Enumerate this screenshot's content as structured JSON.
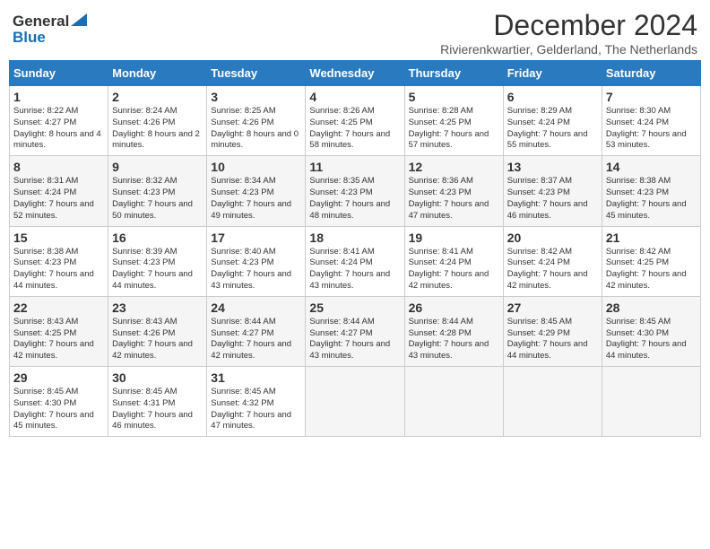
{
  "header": {
    "logo_line1": "General",
    "logo_line2": "Blue",
    "month_title": "December 2024",
    "subtitle": "Rivierenkwartier, Gelderland, The Netherlands"
  },
  "days_of_week": [
    "Sunday",
    "Monday",
    "Tuesday",
    "Wednesday",
    "Thursday",
    "Friday",
    "Saturday"
  ],
  "weeks": [
    [
      {
        "day": "1",
        "sunrise": "8:22 AM",
        "sunset": "4:27 PM",
        "daylight": "8 hours and 4 minutes."
      },
      {
        "day": "2",
        "sunrise": "8:24 AM",
        "sunset": "4:26 PM",
        "daylight": "8 hours and 2 minutes."
      },
      {
        "day": "3",
        "sunrise": "8:25 AM",
        "sunset": "4:26 PM",
        "daylight": "8 hours and 0 minutes."
      },
      {
        "day": "4",
        "sunrise": "8:26 AM",
        "sunset": "4:25 PM",
        "daylight": "7 hours and 58 minutes."
      },
      {
        "day": "5",
        "sunrise": "8:28 AM",
        "sunset": "4:25 PM",
        "daylight": "7 hours and 57 minutes."
      },
      {
        "day": "6",
        "sunrise": "8:29 AM",
        "sunset": "4:24 PM",
        "daylight": "7 hours and 55 minutes."
      },
      {
        "day": "7",
        "sunrise": "8:30 AM",
        "sunset": "4:24 PM",
        "daylight": "7 hours and 53 minutes."
      }
    ],
    [
      {
        "day": "8",
        "sunrise": "8:31 AM",
        "sunset": "4:24 PM",
        "daylight": "7 hours and 52 minutes."
      },
      {
        "day": "9",
        "sunrise": "8:32 AM",
        "sunset": "4:23 PM",
        "daylight": "7 hours and 50 minutes."
      },
      {
        "day": "10",
        "sunrise": "8:34 AM",
        "sunset": "4:23 PM",
        "daylight": "7 hours and 49 minutes."
      },
      {
        "day": "11",
        "sunrise": "8:35 AM",
        "sunset": "4:23 PM",
        "daylight": "7 hours and 48 minutes."
      },
      {
        "day": "12",
        "sunrise": "8:36 AM",
        "sunset": "4:23 PM",
        "daylight": "7 hours and 47 minutes."
      },
      {
        "day": "13",
        "sunrise": "8:37 AM",
        "sunset": "4:23 PM",
        "daylight": "7 hours and 46 minutes."
      },
      {
        "day": "14",
        "sunrise": "8:38 AM",
        "sunset": "4:23 PM",
        "daylight": "7 hours and 45 minutes."
      }
    ],
    [
      {
        "day": "15",
        "sunrise": "8:38 AM",
        "sunset": "4:23 PM",
        "daylight": "7 hours and 44 minutes."
      },
      {
        "day": "16",
        "sunrise": "8:39 AM",
        "sunset": "4:23 PM",
        "daylight": "7 hours and 44 minutes."
      },
      {
        "day": "17",
        "sunrise": "8:40 AM",
        "sunset": "4:23 PM",
        "daylight": "7 hours and 43 minutes."
      },
      {
        "day": "18",
        "sunrise": "8:41 AM",
        "sunset": "4:24 PM",
        "daylight": "7 hours and 43 minutes."
      },
      {
        "day": "19",
        "sunrise": "8:41 AM",
        "sunset": "4:24 PM",
        "daylight": "7 hours and 42 minutes."
      },
      {
        "day": "20",
        "sunrise": "8:42 AM",
        "sunset": "4:24 PM",
        "daylight": "7 hours and 42 minutes."
      },
      {
        "day": "21",
        "sunrise": "8:42 AM",
        "sunset": "4:25 PM",
        "daylight": "7 hours and 42 minutes."
      }
    ],
    [
      {
        "day": "22",
        "sunrise": "8:43 AM",
        "sunset": "4:25 PM",
        "daylight": "7 hours and 42 minutes."
      },
      {
        "day": "23",
        "sunrise": "8:43 AM",
        "sunset": "4:26 PM",
        "daylight": "7 hours and 42 minutes."
      },
      {
        "day": "24",
        "sunrise": "8:44 AM",
        "sunset": "4:27 PM",
        "daylight": "7 hours and 42 minutes."
      },
      {
        "day": "25",
        "sunrise": "8:44 AM",
        "sunset": "4:27 PM",
        "daylight": "7 hours and 43 minutes."
      },
      {
        "day": "26",
        "sunrise": "8:44 AM",
        "sunset": "4:28 PM",
        "daylight": "7 hours and 43 minutes."
      },
      {
        "day": "27",
        "sunrise": "8:45 AM",
        "sunset": "4:29 PM",
        "daylight": "7 hours and 44 minutes."
      },
      {
        "day": "28",
        "sunrise": "8:45 AM",
        "sunset": "4:30 PM",
        "daylight": "7 hours and 44 minutes."
      }
    ],
    [
      {
        "day": "29",
        "sunrise": "8:45 AM",
        "sunset": "4:30 PM",
        "daylight": "7 hours and 45 minutes."
      },
      {
        "day": "30",
        "sunrise": "8:45 AM",
        "sunset": "4:31 PM",
        "daylight": "7 hours and 46 minutes."
      },
      {
        "day": "31",
        "sunrise": "8:45 AM",
        "sunset": "4:32 PM",
        "daylight": "7 hours and 47 minutes."
      },
      null,
      null,
      null,
      null
    ]
  ]
}
